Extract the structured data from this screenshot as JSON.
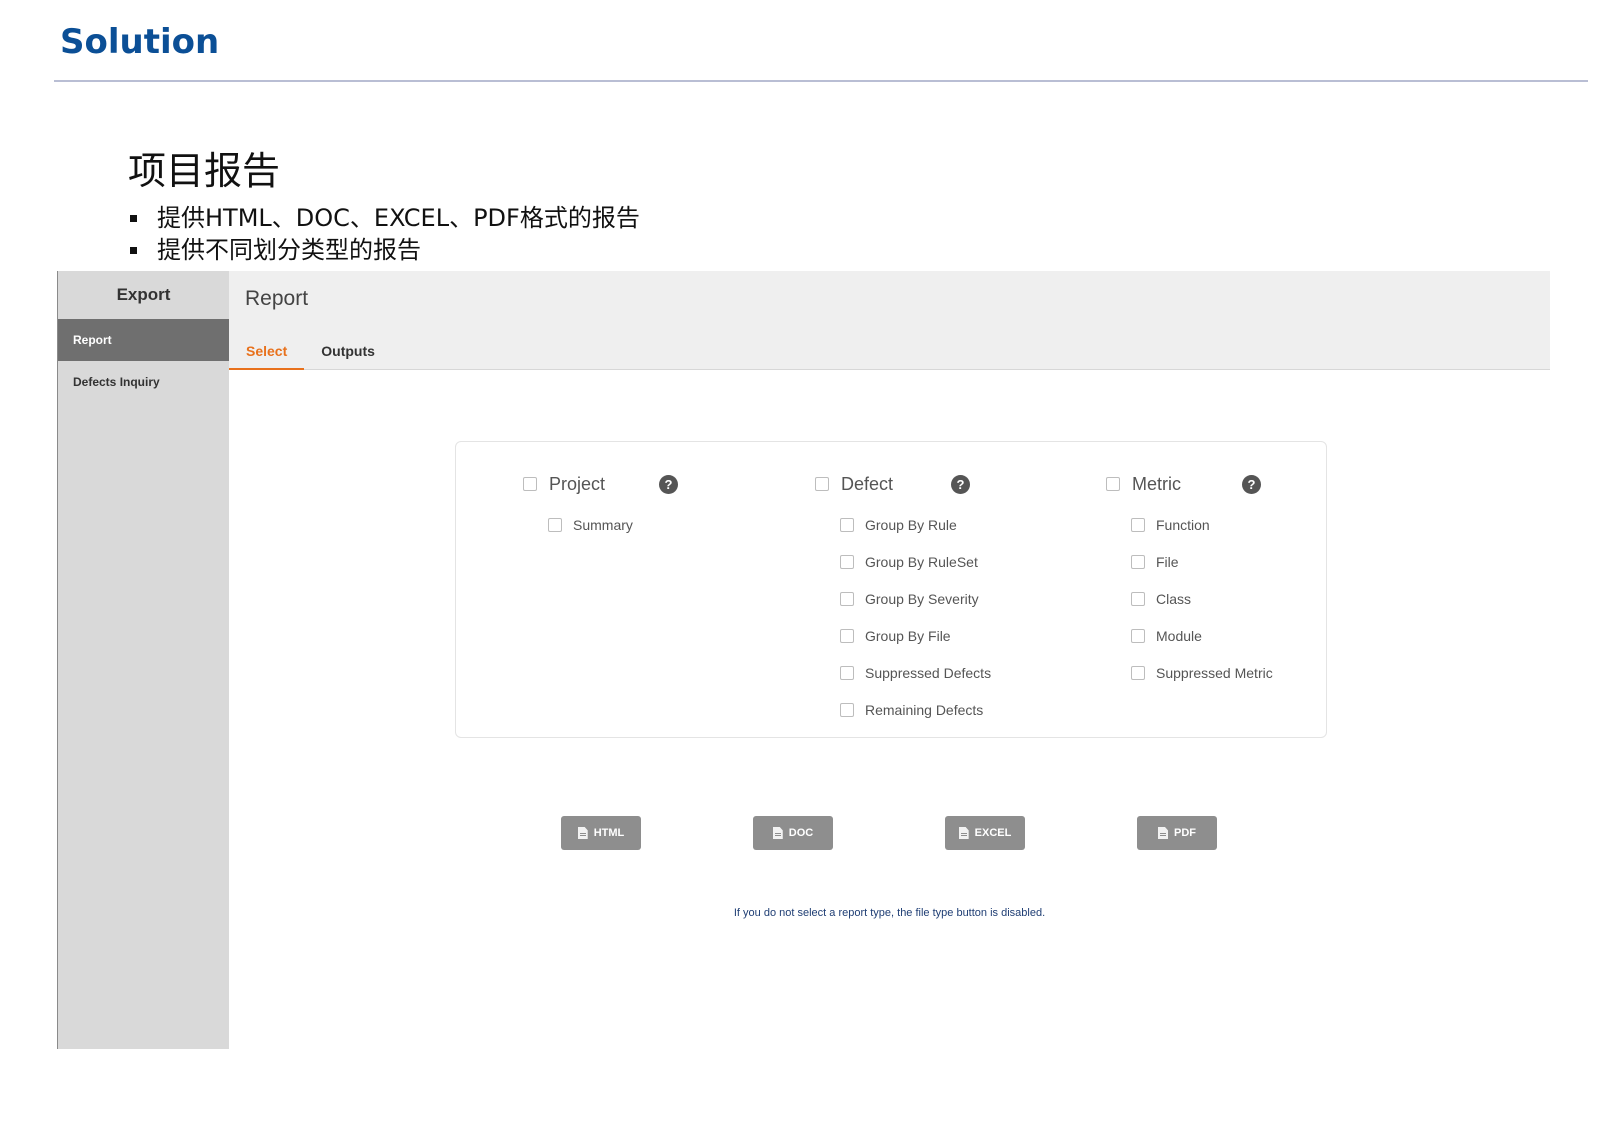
{
  "slide": {
    "title": "Solution",
    "heading": "项目报告",
    "bullets": [
      "提供HTML、DOC、EXCEL、PDF格式的报告",
      "提供不同划分类型的报告"
    ]
  },
  "sidebar": {
    "header": "Export",
    "items": [
      {
        "label": "Report",
        "active": true
      },
      {
        "label": "Defects Inquiry",
        "active": false
      }
    ]
  },
  "main": {
    "title": "Report",
    "tabs": [
      {
        "label": "Select",
        "active": true
      },
      {
        "label": "Outputs",
        "active": false
      }
    ]
  },
  "report_groups": [
    {
      "label": "Project",
      "help_icon": "question-circle-icon",
      "options": [
        "Summary"
      ]
    },
    {
      "label": "Defect",
      "help_icon": "question-circle-icon",
      "options": [
        "Group By Rule",
        "Group By RuleSet",
        "Group By Severity",
        "Group By File",
        "Suppressed Defects",
        "Remaining Defects"
      ]
    },
    {
      "label": "Metric",
      "help_icon": "question-circle-icon",
      "options": [
        "Function",
        "File",
        "Class",
        "Module",
        "Suppressed Metric"
      ]
    }
  ],
  "file_buttons": [
    {
      "label": "HTML",
      "icon": "file-html-icon"
    },
    {
      "label": "DOC",
      "icon": "file-doc-icon"
    },
    {
      "label": "EXCEL",
      "icon": "file-excel-icon"
    },
    {
      "label": "PDF",
      "icon": "file-pdf-icon"
    }
  ],
  "note": "If you do not select a report type, the file type button is disabled.",
  "colors": {
    "accent": "#e8711c",
    "title_blue": "#0b4f96",
    "button_gray": "#8e8e8e",
    "sidebar_bg": "#d9d9d9",
    "sidebar_active": "#6f6f6f"
  }
}
